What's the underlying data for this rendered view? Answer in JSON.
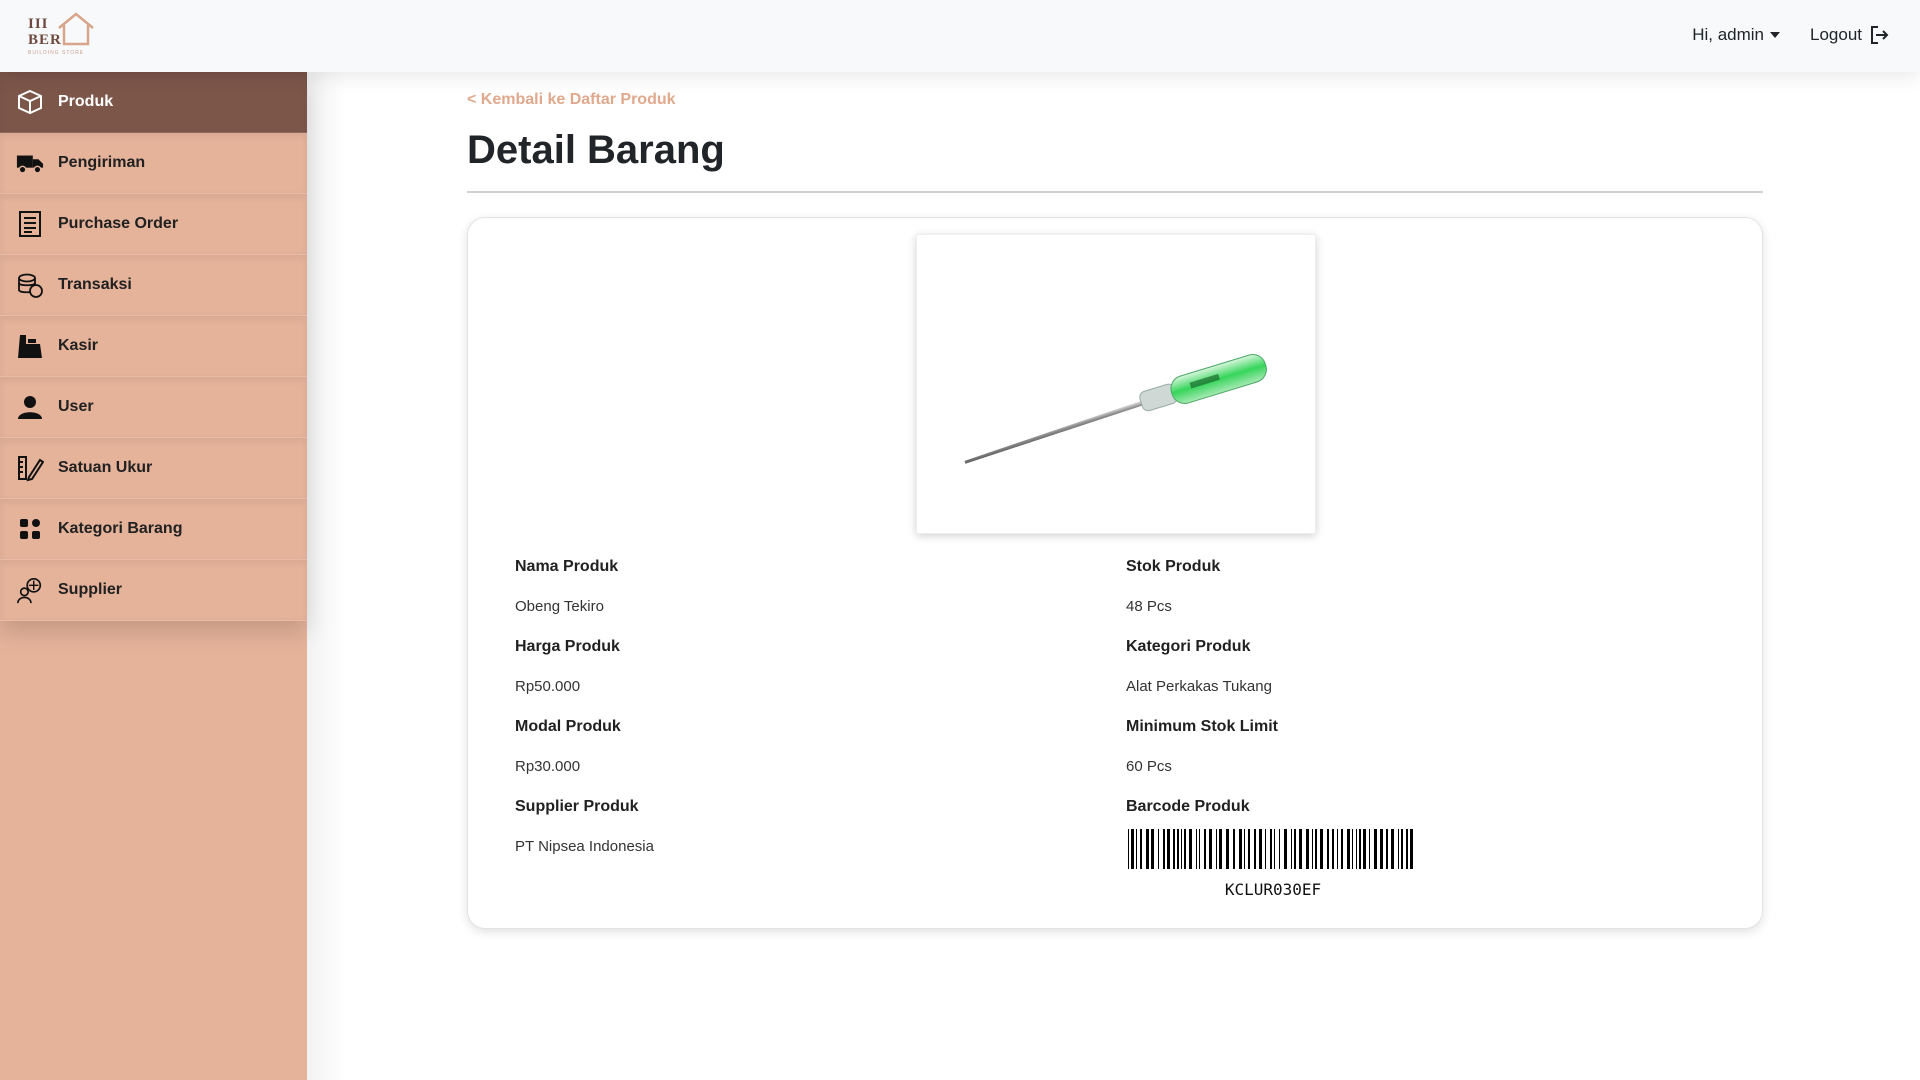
{
  "app": {
    "logo_text": "III\nBER",
    "logo_subtitle": "BUILDING STORE"
  },
  "header": {
    "greeting": "Hi, admin",
    "logout_label": "Logout"
  },
  "sidebar": {
    "items": [
      {
        "label": "Produk",
        "icon": "box-icon",
        "active": true
      },
      {
        "label": "Pengiriman",
        "icon": "truck-icon",
        "active": false
      },
      {
        "label": "Purchase Order",
        "icon": "order-list-icon",
        "active": false
      },
      {
        "label": "Transaksi",
        "icon": "coins-icon",
        "active": false
      },
      {
        "label": "Kasir",
        "icon": "cashier-icon",
        "active": false
      },
      {
        "label": "User",
        "icon": "user-icon",
        "active": false
      },
      {
        "label": "Satuan Ukur",
        "icon": "ruler-pencil-icon",
        "active": false
      },
      {
        "label": "Kategori Barang",
        "icon": "grid-icon",
        "active": false
      },
      {
        "label": "Supplier",
        "icon": "supplier-icon",
        "active": false
      }
    ]
  },
  "page": {
    "back_link": "< Kembali ke Daftar Produk",
    "title": "Detail Barang"
  },
  "product": {
    "image_icon": "screwdriver-image",
    "fields_left": [
      {
        "label": "Nama Produk",
        "value": "Obeng Tekiro"
      },
      {
        "label": "Harga Produk",
        "value": "Rp50.000"
      },
      {
        "label": "Modal Produk",
        "value": "Rp30.000"
      },
      {
        "label": "Supplier Produk",
        "value": "PT Nipsea Indonesia"
      }
    ],
    "fields_right": [
      {
        "label": "Stok Produk",
        "value": "48 Pcs"
      },
      {
        "label": "Kategori Produk",
        "value": "Alat Perkakas Tukang"
      },
      {
        "label": "Minimum Stok Limit",
        "value": "60 Pcs"
      },
      {
        "label": "Barcode Produk",
        "value": "KCLUR030EF"
      }
    ]
  },
  "colors": {
    "sidebar_bg": "#e5b29a",
    "sidebar_active": "#7d564a",
    "accent_link": "#e0a98d"
  }
}
